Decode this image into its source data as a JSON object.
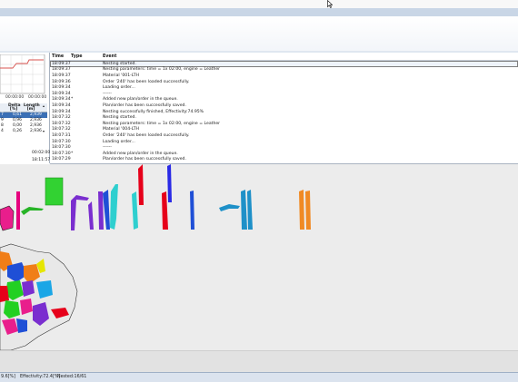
{
  "chart_ticks": [
    "00:00:00",
    "00:00:00"
  ],
  "stats": {
    "headers": [
      "Delta\n[%]",
      "Length\n[m]"
    ],
    "rows": [
      {
        "a": "7",
        "delta": "0,61",
        "length": "2,939"
      },
      {
        "a": "9",
        "delta": "0,96",
        "length": "2,936"
      },
      {
        "a": "8",
        "delta": "0,00",
        "length": "2,936"
      },
      {
        "a": "4",
        "delta": "0,26",
        "length": "2,936"
      }
    ],
    "time1": "00:02:00",
    "time2": "18:11:57"
  },
  "log": {
    "columns": {
      "time": "Time",
      "type": "Type",
      "event": "Event"
    },
    "rows": [
      {
        "time": "18:09:37",
        "type": "",
        "event": "Nesting started."
      },
      {
        "time": "18:09:37",
        "type": "",
        "event": "Nesting parameters: time = 1x 02:00, engine = Leather"
      },
      {
        "time": "18:09:37",
        "type": "",
        "event": "Material '001-LTH"
      },
      {
        "time": "18:09:36",
        "type": "",
        "event": "Order '240' has been loaded successfully."
      },
      {
        "time": "18:09:34",
        "type": "",
        "event": "Loading order..."
      },
      {
        "time": "18:09:34",
        "type": "",
        "event": "------"
      },
      {
        "time": "18:09:34",
        "type": "*",
        "event": "Added new plan/order in the queue."
      },
      {
        "time": "18:09:34",
        "type": "",
        "event": "Plan/order has been successfully saved."
      },
      {
        "time": "18:09:34",
        "type": "",
        "event": "Nesting successfully finished, Effectivity:74.95%"
      },
      {
        "time": "18:07:32",
        "type": "",
        "event": "Nesting started."
      },
      {
        "time": "18:07:32",
        "type": "",
        "event": "Nesting parameters: time = 1x 02:00, engine = Leather"
      },
      {
        "time": "18:07:32",
        "type": "",
        "event": "Material '004-LTH"
      },
      {
        "time": "18:07:31",
        "type": "",
        "event": "Order '240' has been loaded successfully."
      },
      {
        "time": "18:07:30",
        "type": "",
        "event": "Loading order..."
      },
      {
        "time": "18:07:30",
        "type": "",
        "event": "------"
      },
      {
        "time": "18:07:30",
        "type": "*",
        "event": "Added new plan/order in the queue."
      },
      {
        "time": "18:07:29",
        "type": "",
        "event": "Plan/order has been successfully saved."
      }
    ]
  },
  "status": {
    "zoom": "9.6[%]",
    "effectivity": "Effectivity:72.4[%]",
    "nested": "Nested:16/61"
  },
  "colors": {
    "accent": "#3a6fb5",
    "chart_line": "#d9534f"
  }
}
